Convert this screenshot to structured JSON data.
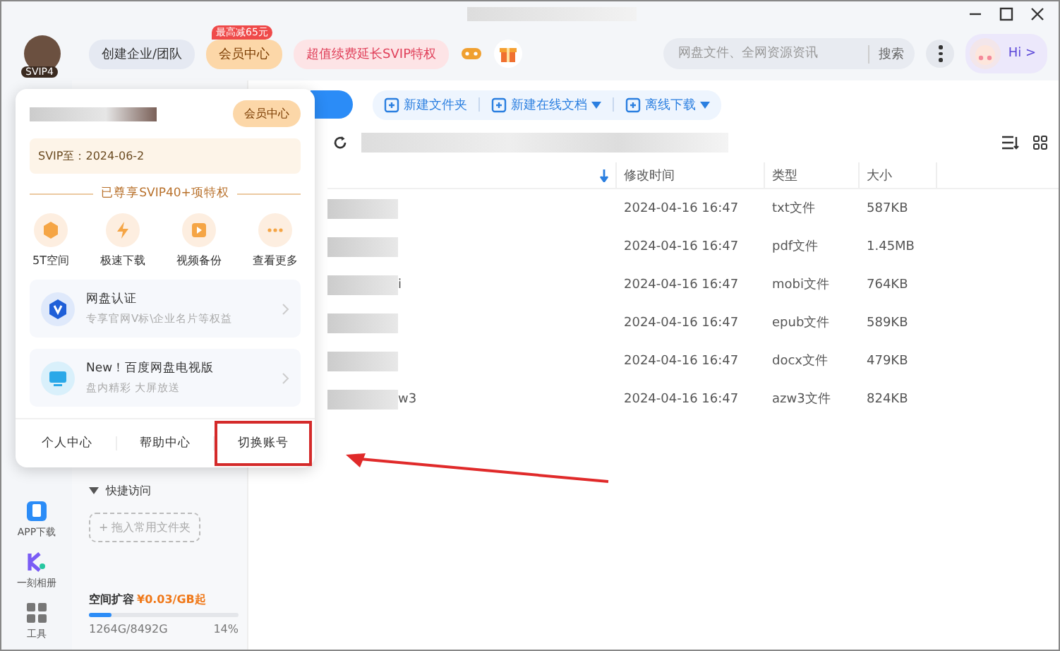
{
  "header": {
    "avatar_badge": "SVIP4",
    "team_button": "创建企业/团队",
    "vip_button": "会员中心",
    "vip_badge": "最高减65元",
    "renew_button": "超值续费延长SVIP特权",
    "search": {
      "placeholder": "网盘文件、全网资源资讯",
      "button": "搜索"
    },
    "hi": "Hi >"
  },
  "toolbar": {
    "buttons": [
      {
        "label": "新建文件夹",
        "dropdown": false
      },
      {
        "label": "新建在线文档",
        "dropdown": true
      },
      {
        "label": "离线下载",
        "dropdown": true
      }
    ]
  },
  "table": {
    "columns": [
      "",
      "修改时间",
      "类型",
      "大小"
    ],
    "rows": [
      {
        "name": "",
        "time": "2024-04-16 16:47",
        "type": "txt文件",
        "size": "587KB"
      },
      {
        "name": "",
        "time": "2024-04-16 16:47",
        "type": "pdf文件",
        "size": "1.45MB"
      },
      {
        "name": "i",
        "time": "2024-04-16 16:47",
        "type": "mobi文件",
        "size": "764KB"
      },
      {
        "name": "",
        "time": "2024-04-16 16:47",
        "type": "epub文件",
        "size": "589KB"
      },
      {
        "name": "",
        "time": "2024-04-16 16:47",
        "type": "docx文件",
        "size": "479KB"
      },
      {
        "name": "w3",
        "time": "2024-04-16 16:47",
        "type": "azw3文件",
        "size": "824KB"
      }
    ]
  },
  "rail": [
    {
      "label": "APP下载",
      "kind": "phone"
    },
    {
      "label": "一刻相册",
      "kind": "album"
    },
    {
      "label": "工具",
      "kind": "tools"
    }
  ],
  "sidebar": {
    "quick_title": "快捷访问",
    "drop_hint": "+ 拖入常用文件夹",
    "expand_label": "空间扩容",
    "expand_price": "¥0.03/GB起",
    "usage": "1264G/8492G",
    "percent": "14%",
    "level": 0.15
  },
  "popover": {
    "vip_button": "会员中心",
    "expiry": "SVIP至：2024-06-2",
    "privilege_title": "已尊享SVIP40+项特权",
    "features": [
      {
        "label": "5T空间",
        "kind": "box"
      },
      {
        "label": "极速下载",
        "kind": "bolt"
      },
      {
        "label": "视频备份",
        "kind": "video"
      },
      {
        "label": "查看更多",
        "kind": "more"
      }
    ],
    "cards": [
      {
        "title": "网盘认证",
        "subtitle": "专享官网V标\\企业名片等权益",
        "kind": "verify"
      },
      {
        "title": "New！百度网盘电视版",
        "subtitle": "盘内精彩 大屏放送",
        "kind": "tv"
      }
    ],
    "footer": [
      {
        "label": "个人中心",
        "highlighted": false
      },
      {
        "label": "帮助中心",
        "highlighted": false
      },
      {
        "label": "切换账号",
        "highlighted": true
      }
    ]
  }
}
